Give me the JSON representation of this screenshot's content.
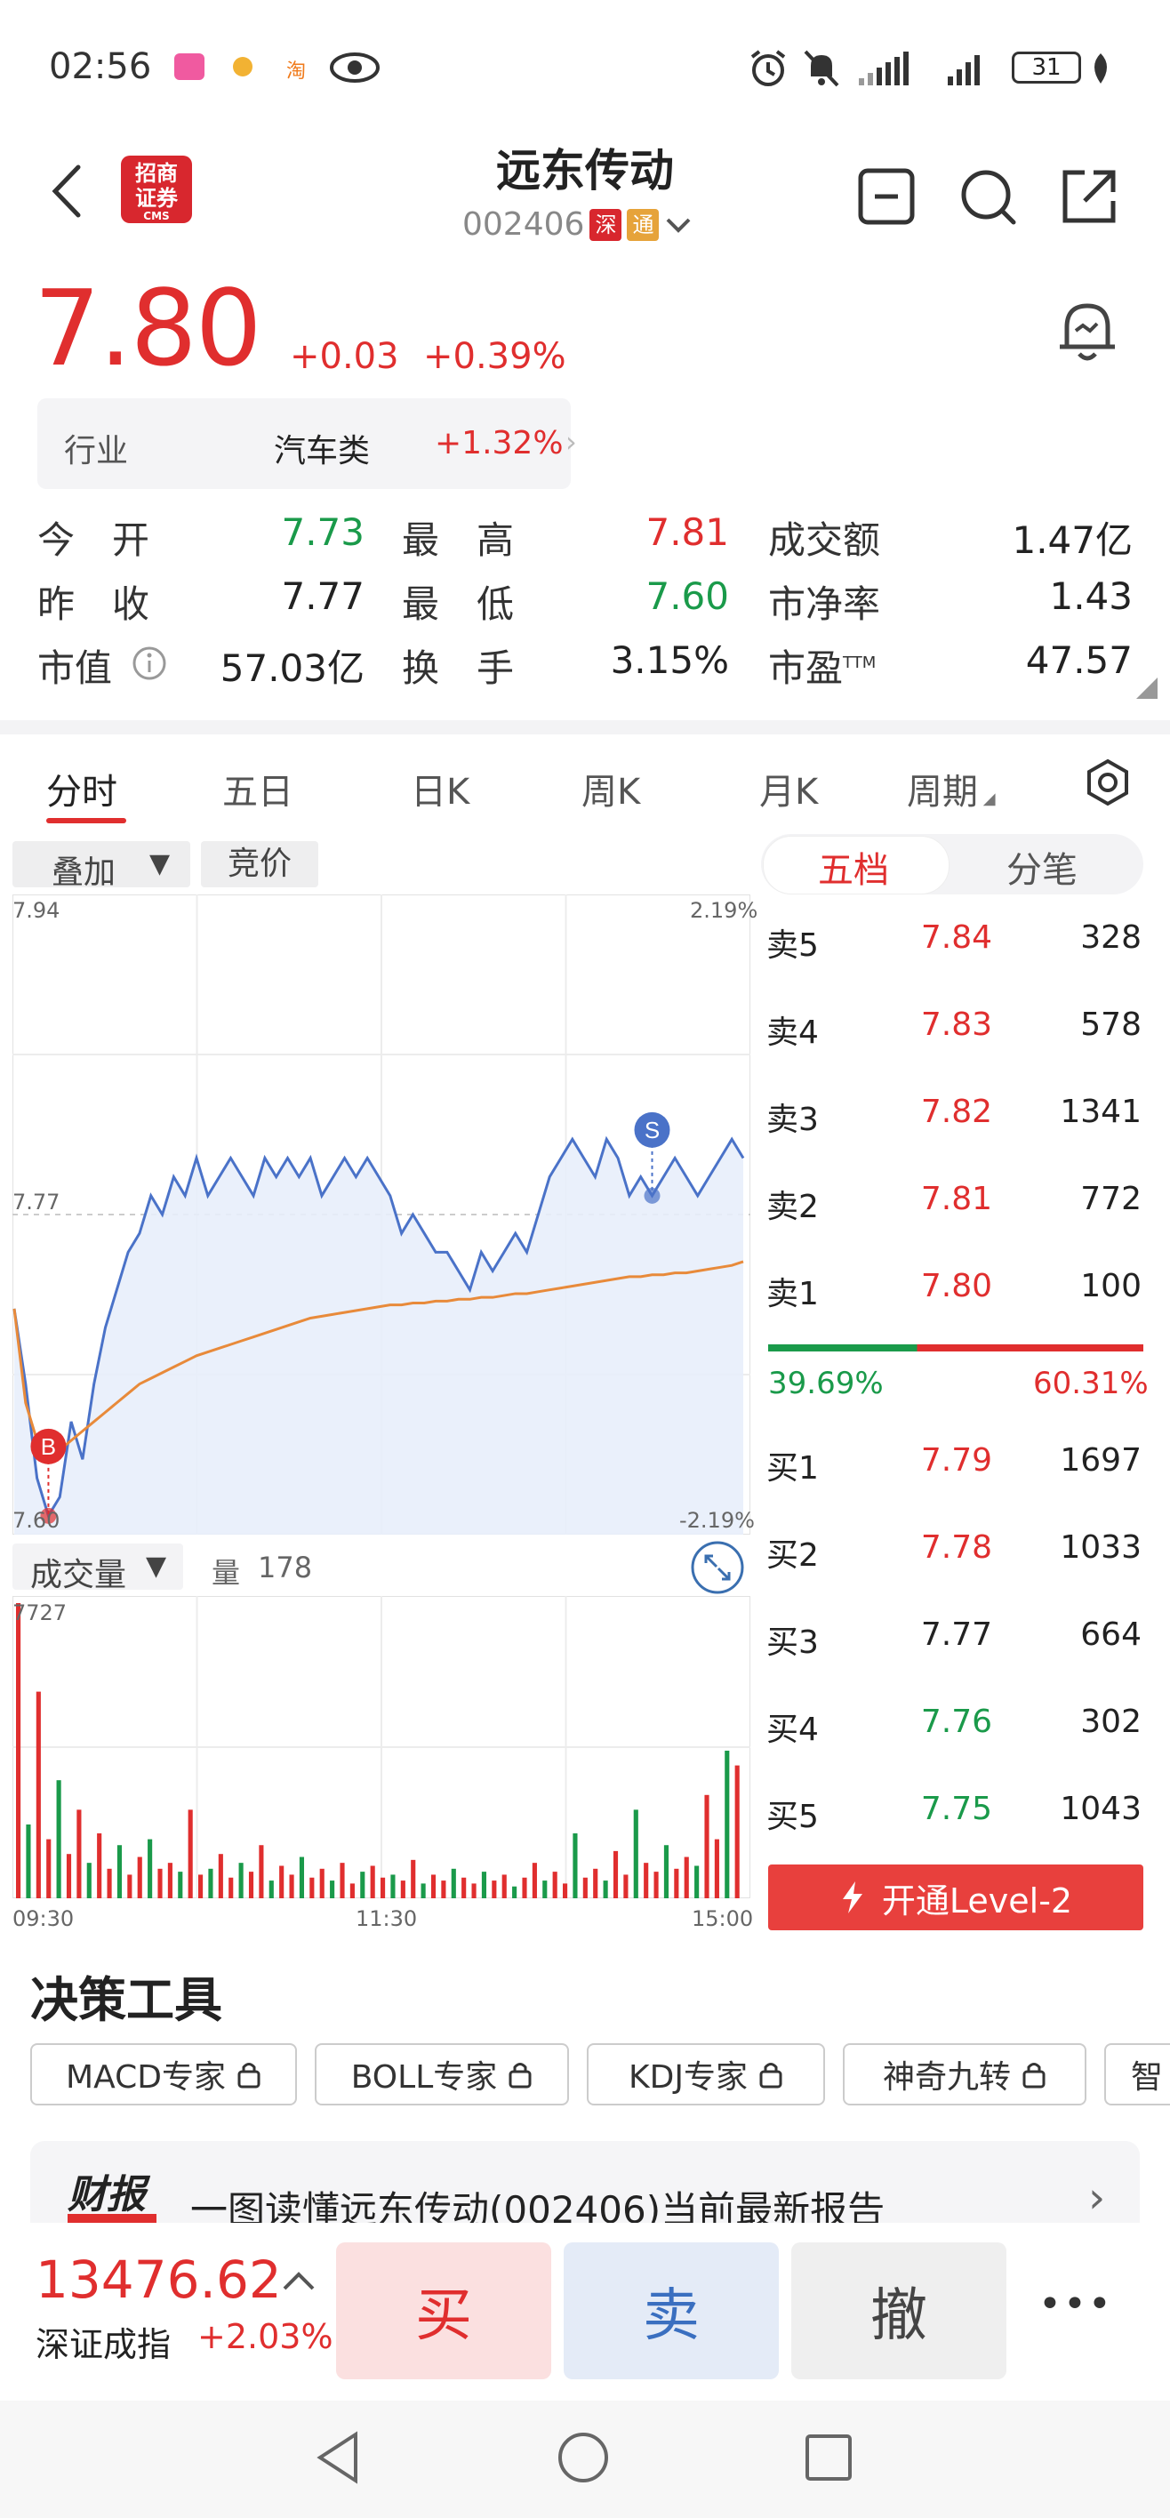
{
  "status_bar": {
    "time": "02:56",
    "battery": "31"
  },
  "header": {
    "title": "远东传动",
    "code": "002406",
    "market_tag": "深",
    "connect_tag": "通",
    "broker_logo_text": "招商证券",
    "broker_logo_sub": "CMS"
  },
  "quote": {
    "price": "7.80",
    "change": "+0.03",
    "change_pct": "+0.39%",
    "industry_label": "行业",
    "industry_name": "汽车类",
    "industry_pct": "+1.32%",
    "stats": {
      "open_label": "今　开",
      "open": "7.73",
      "high_label": "最　高",
      "high": "7.81",
      "turnover_amt_label": "成交额",
      "turnover_amt": "1.47亿",
      "prev_label": "昨　收",
      "prev": "7.77",
      "low_label": "最　低",
      "low": "7.60",
      "pb_label": "市净率",
      "pb": "1.43",
      "mcap_label": "市值",
      "mcap": "57.03亿",
      "turnover_label": "换　手",
      "turnover": "3.15%",
      "pe_label": "市盈",
      "pe_sup": "TTM",
      "pe": "47.57"
    }
  },
  "tabs": [
    "分时",
    "五日",
    "日K",
    "周K",
    "月K",
    "周期"
  ],
  "chart_controls": {
    "overlay": "叠加",
    "auction": "竞价"
  },
  "chart_data": {
    "type": "line",
    "y_top_label": "7.94",
    "y_mid_label": "7.77",
    "y_bottom_label": "7.60",
    "pct_top_label": "2.19%",
    "pct_bottom_label": "-2.19%",
    "ylim": [
      7.6,
      7.94
    ],
    "prev_close": 7.77,
    "price": [
      7.72,
      7.68,
      7.63,
      7.61,
      7.62,
      7.66,
      7.64,
      7.68,
      7.71,
      7.73,
      7.75,
      7.76,
      7.78,
      7.77,
      7.79,
      7.78,
      7.8,
      7.78,
      7.79,
      7.8,
      7.79,
      7.78,
      7.8,
      7.79,
      7.8,
      7.79,
      7.8,
      7.78,
      7.79,
      7.8,
      7.79,
      7.8,
      7.79,
      7.78,
      7.76,
      7.77,
      7.76,
      7.75,
      7.75,
      7.74,
      7.73,
      7.75,
      7.74,
      7.75,
      7.76,
      7.75,
      7.77,
      7.79,
      7.8,
      7.81,
      7.8,
      7.79,
      7.81,
      7.8,
      7.78,
      7.79,
      7.78,
      7.79,
      7.8,
      7.79,
      7.78,
      7.79,
      7.8,
      7.81,
      7.8
    ],
    "avg": [
      7.72,
      7.67,
      7.65,
      7.645,
      7.645,
      7.65,
      7.655,
      7.66,
      7.665,
      7.67,
      7.675,
      7.68,
      7.683,
      7.686,
      7.689,
      7.692,
      7.695,
      7.697,
      7.699,
      7.701,
      7.703,
      7.705,
      7.707,
      7.709,
      7.711,
      7.713,
      7.715,
      7.716,
      7.717,
      7.718,
      7.719,
      7.72,
      7.721,
      7.722,
      7.722,
      7.723,
      7.723,
      7.724,
      7.724,
      7.725,
      7.725,
      7.726,
      7.726,
      7.727,
      7.728,
      7.728,
      7.729,
      7.73,
      7.731,
      7.732,
      7.733,
      7.734,
      7.735,
      7.736,
      7.737,
      7.737,
      7.738,
      7.738,
      7.739,
      7.739,
      7.74,
      7.741,
      7.742,
      7.743,
      7.745
    ],
    "markers": [
      {
        "label": "B",
        "index": 3
      },
      {
        "label": "S",
        "index": 56
      }
    ],
    "x_tick_labels": [
      "09:30",
      "11:30",
      "15:00"
    ]
  },
  "volume": {
    "label": "成交量",
    "qty_label": "量",
    "qty_value": "178",
    "max_label": "7727",
    "bars": [
      1.0,
      0.25,
      0.7,
      0.2,
      0.4,
      0.15,
      0.3,
      0.12,
      0.22,
      0.1,
      0.18,
      0.08,
      0.14,
      0.2,
      0.1,
      0.12,
      0.09,
      0.3,
      0.08,
      0.1,
      0.15,
      0.07,
      0.12,
      0.09,
      0.18,
      0.06,
      0.11,
      0.08,
      0.14,
      0.07,
      0.1,
      0.06,
      0.12,
      0.05,
      0.09,
      0.11,
      0.07,
      0.08,
      0.06,
      0.13,
      0.05,
      0.08,
      0.06,
      0.1,
      0.07,
      0.05,
      0.09,
      0.06,
      0.08,
      0.04,
      0.07,
      0.12,
      0.06,
      0.09,
      0.05,
      0.22,
      0.07,
      0.1,
      0.06,
      0.16,
      0.08,
      0.3,
      0.12,
      0.09,
      0.18,
      0.1,
      0.14,
      0.11,
      0.35,
      0.2,
      0.5,
      0.45
    ]
  },
  "order_book": {
    "tab_five": "五档",
    "tab_tick": "分笔",
    "sell": [
      {
        "label": "卖5",
        "price": "7.84",
        "vol": "328"
      },
      {
        "label": "卖4",
        "price": "7.83",
        "vol": "578"
      },
      {
        "label": "卖3",
        "price": "7.82",
        "vol": "1341"
      },
      {
        "label": "卖2",
        "price": "7.81",
        "vol": "772"
      },
      {
        "label": "卖1",
        "price": "7.80",
        "vol": "100"
      }
    ],
    "buy_ratio": "39.69%",
    "sell_ratio": "60.31%",
    "buy_ratio_value": 0.3969,
    "buy": [
      {
        "label": "买1",
        "price": "7.79",
        "vol": "1697",
        "color": "#e02e2e"
      },
      {
        "label": "买2",
        "price": "7.78",
        "vol": "1033",
        "color": "#e02e2e"
      },
      {
        "label": "买3",
        "price": "7.77",
        "vol": "664",
        "color": "#222222"
      },
      {
        "label": "买4",
        "price": "7.76",
        "vol": "302",
        "color": "#1a9a4a"
      },
      {
        "label": "买5",
        "price": "7.75",
        "vol": "1043",
        "color": "#1a9a4a"
      }
    ],
    "level2_label": "开通Level-2"
  },
  "tools": {
    "title": "决策工具",
    "chips": [
      "MACD专家",
      "BOLL专家",
      "KDJ专家",
      "神奇九转",
      "智"
    ]
  },
  "report": {
    "badge": "财报",
    "text": "一图读懂远东传动(002406)当前最新报告"
  },
  "bottom": {
    "index_value": "13476.62",
    "index_name": "深证成指",
    "index_change": "+2.03%",
    "buy": "买",
    "sell": "卖",
    "cancel": "撤",
    "more": "•••"
  }
}
